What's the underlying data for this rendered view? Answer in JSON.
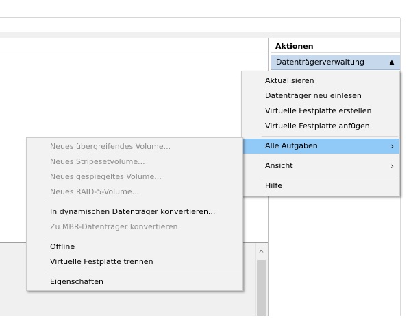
{
  "actions": {
    "title": "Aktionen",
    "section": "Datenträgerverwaltung",
    "section_arrow": "▲"
  },
  "context_menu": {
    "items": [
      {
        "label": "Aktualisieren"
      },
      {
        "label": "Datenträger neu einlesen"
      },
      {
        "label": "Virtuelle Festplatte erstellen"
      },
      {
        "label": "Virtuelle Festplatte anfügen"
      },
      {
        "label": "Alle Aufgaben",
        "has_submenu": true,
        "highlighted": true
      },
      {
        "label": "Ansicht",
        "has_submenu": true
      },
      {
        "label": "Hilfe"
      }
    ],
    "submenu_arrow": "›"
  },
  "submenu": {
    "items": [
      {
        "label": "Neues übergreifendes Volume...",
        "enabled": false
      },
      {
        "label": "Neues Stripesetvolume...",
        "enabled": false
      },
      {
        "label": "Neues gespiegeltes Volume...",
        "enabled": false
      },
      {
        "label": "Neues RAID-5-Volume...",
        "enabled": false
      },
      {
        "label": "In dynamischen Datenträger konvertieren...",
        "enabled": true
      },
      {
        "label": "Zu MBR-Datenträger konvertieren",
        "enabled": false
      },
      {
        "label": "Offline",
        "enabled": true
      },
      {
        "label": "Virtuelle Festplatte trennen",
        "enabled": true
      },
      {
        "label": "Eigenschaften",
        "enabled": true
      }
    ]
  },
  "scrollbar": {
    "up_arrow": "^"
  }
}
